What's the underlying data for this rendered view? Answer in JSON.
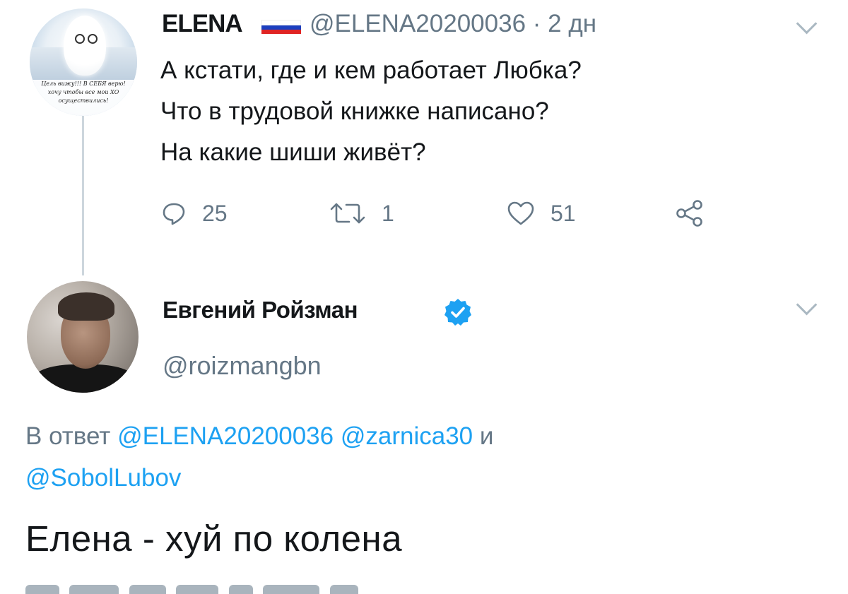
{
  "parent_tweet": {
    "author_name": "ELENA",
    "handle": "@ELENA20200036",
    "time_separator": "·",
    "time": "2 дн",
    "avatar_caption": [
      "Цель вижу!!! В СЕБЯ верю!",
      "хочу чтобы все мои ХО",
      "осуществились!"
    ],
    "text_lines": [
      "А кстати, где и кем работает Любка?",
      "Что в трудовой книжке написано?",
      "На какие шиши живёт?"
    ],
    "actions": {
      "replies": "25",
      "retweets": "1",
      "likes": "51"
    },
    "flag_colors": [
      "#ffffff",
      "#1c3fbf",
      "#e02424"
    ]
  },
  "reply_tweet": {
    "author_name": "Евгений Ройзман",
    "verified": true,
    "handle": "@roizmangbn",
    "reply_prefix": "В ответ",
    "reply_mentions": [
      "@ELENA20200036",
      "@zarnica30"
    ],
    "reply_conjunction": "и",
    "reply_mention_last": "@SobolLubov",
    "text": "Елена - хуй по колена"
  },
  "icons": [
    "reply-icon",
    "retweet-icon",
    "like-icon",
    "share-icon",
    "chevron-down-icon",
    "verified-badge-icon"
  ],
  "colors": {
    "text": "#14171a",
    "secondary": "#657786",
    "link": "#1da1f2",
    "verified": "#1da1f2",
    "thread_line": "#cdd6dd"
  }
}
